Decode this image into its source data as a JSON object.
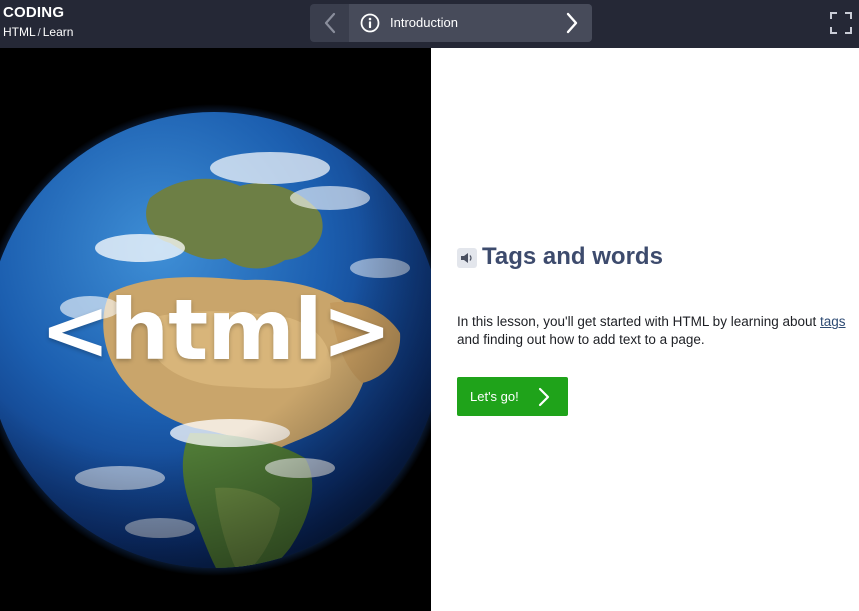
{
  "header": {
    "brand": "CODING",
    "breadcrumb": {
      "course": "HTML",
      "separator": "/",
      "section": "Learn"
    },
    "lesson_nav": {
      "current": "Introduction",
      "prev_icon": "chevron-left-icon",
      "next_icon": "chevron-right-icon",
      "info_icon": "info-circle-icon"
    },
    "fullscreen_icon": "fullscreen-icon"
  },
  "hero": {
    "overlay_text": "<html>",
    "image": "earth-globe"
  },
  "lesson": {
    "title": "Tags and words",
    "audio_icon": "speaker-icon",
    "description_before": "In this lesson, you'll get started with HTML by learning about ",
    "link_text": "tags",
    "description_after": " and finding out how to add text to a page.",
    "button_label": "Let's go!"
  },
  "colors": {
    "topbar": "#252836",
    "nav_center": "#474b5a",
    "title": "#3d4b6d",
    "button": "#1fa31a",
    "link": "#2d4a73"
  }
}
